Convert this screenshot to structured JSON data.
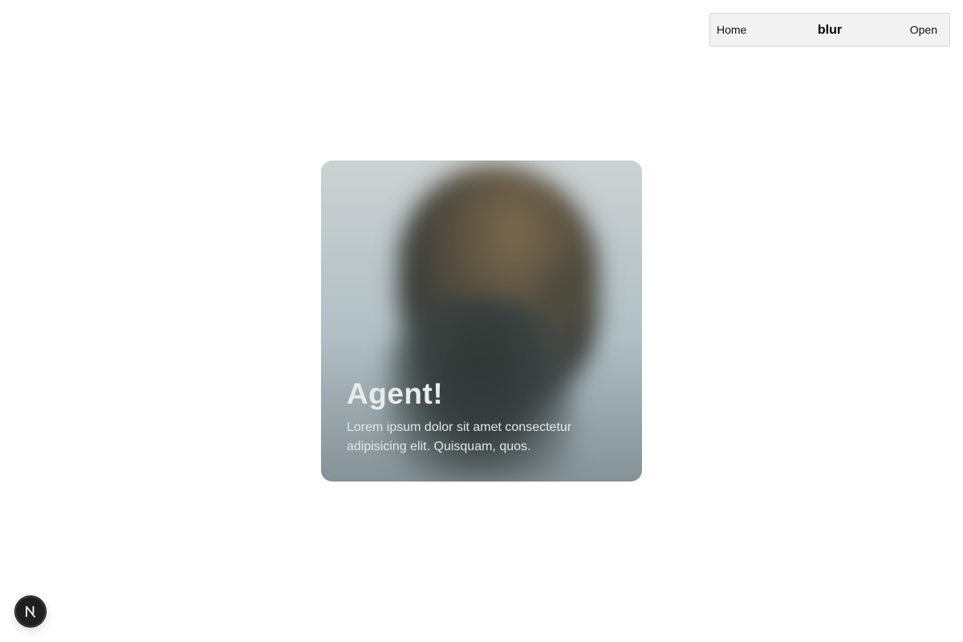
{
  "nav": {
    "home_label": "Home",
    "brand": "blur",
    "open_label": "Open"
  },
  "card": {
    "title": "Agent!",
    "description": "Lorem ipsum dolor sit amet consectetur adipisicing elit. Quisquam, quos."
  },
  "dev_badge": {
    "icon": "nextjs-icon",
    "letter": "N"
  },
  "colors": {
    "page_background": "#ffffff",
    "nav_background": "#f2f2f2",
    "badge_background": "#1f1f1f",
    "card_text": "#e9ebeb"
  }
}
